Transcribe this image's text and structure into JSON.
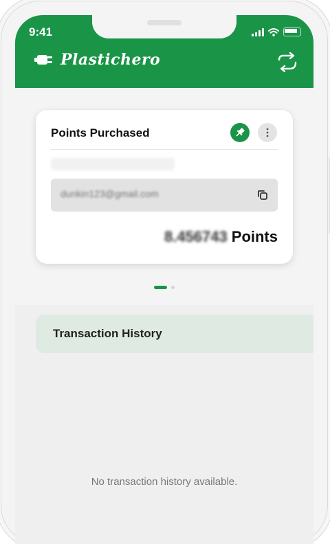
{
  "status_bar": {
    "time": "9:41"
  },
  "header": {
    "brand": "Plastichero",
    "icons": {
      "logo": "plug-icon",
      "swap": "swap-arrows-icon"
    }
  },
  "card": {
    "title": "Points Purchased",
    "email": "dunkin123@gmail.com",
    "points_value": "8.456743",
    "points_unit": "Points",
    "icons": {
      "pin": "pin-icon",
      "more": "more-vertical-icon",
      "copy": "copy-icon"
    }
  },
  "pager": {
    "pages": 2,
    "active": 1
  },
  "history": {
    "title": "Transaction History",
    "empty_message": "No transaction history available."
  },
  "colors": {
    "brand_green": "#1a9447",
    "history_bg": "#dfeae2",
    "screen_bg": "#efefef"
  }
}
